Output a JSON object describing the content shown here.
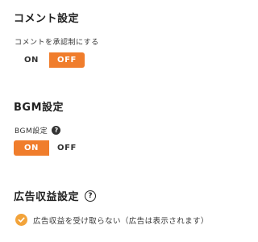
{
  "comments": {
    "title": "コメント設定",
    "approval_label": "コメントを承認制にする",
    "toggle": {
      "on_label": "ON",
      "off_label": "OFF",
      "selected": "OFF"
    }
  },
  "bgm": {
    "title": "BGM設定",
    "label": "BGM設定",
    "toggle": {
      "on_label": "ON",
      "off_label": "OFF",
      "selected": "ON"
    }
  },
  "ad_revenue": {
    "title": "広告収益設定",
    "option_text": "広告収益を受け取らない（広告は表示されます）"
  },
  "icons": {
    "help": "?",
    "help_icon_name": "help-circle-icon",
    "check_icon_name": "check-circle-icon"
  },
  "colors": {
    "accent": "#f07d2c",
    "check": "#f2a33a",
    "text": "#222222"
  }
}
